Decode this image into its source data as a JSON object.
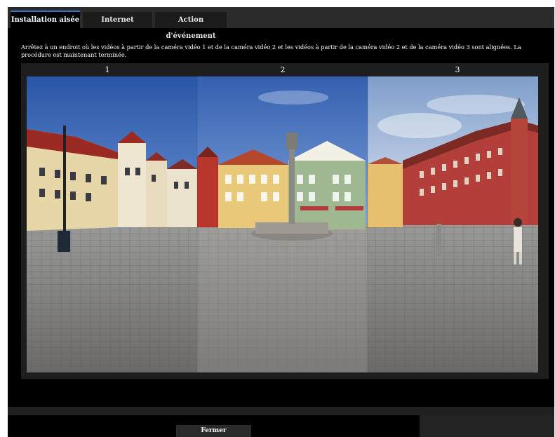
{
  "tabs": [
    {
      "label": "Installation aisée",
      "active": true
    },
    {
      "label": "Internet",
      "active": false
    },
    {
      "label": "Action d'événement",
      "active": false
    }
  ],
  "instructions": "Arrêtez à un endroit où les vidéos à partir de la caméra vidéo 1 et de la caméra vidéo 2 et les vidéos à partir de la caméra vidéo 2 et de la caméra vidéo 3 sont alignées. La procédure est maintenant terminée.",
  "cameras": [
    {
      "label": "1"
    },
    {
      "label": "2"
    },
    {
      "label": "3"
    }
  ],
  "footer": {
    "close_label": "Fermer"
  },
  "colors": {
    "background": "#000000",
    "tab_active_accent": "#3b6fd0",
    "panel": "#1e1e1e"
  }
}
